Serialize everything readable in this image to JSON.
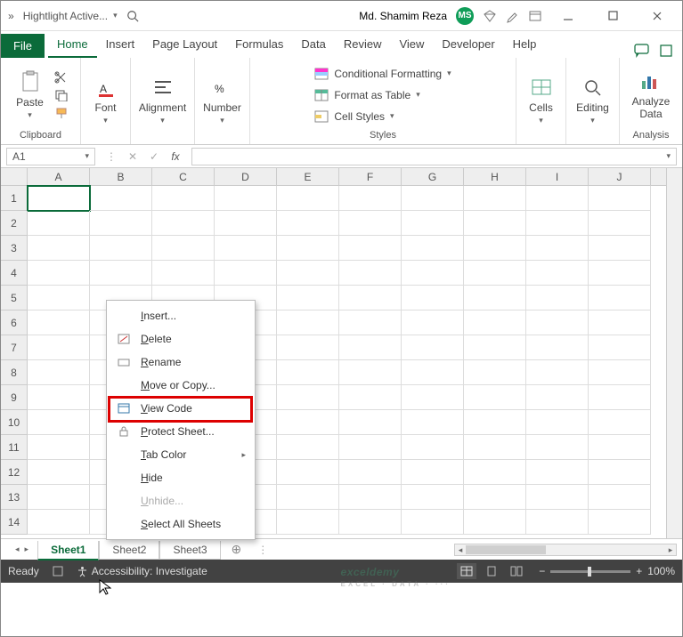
{
  "title": {
    "chevron": "»",
    "filename": "Hightlight Active...",
    "user": "Md. Shamim Reza",
    "avatar": "MS"
  },
  "tabs": {
    "file": "File",
    "home": "Home",
    "insert": "Insert",
    "page_layout": "Page Layout",
    "formulas": "Formulas",
    "data": "Data",
    "review": "Review",
    "view": "View",
    "developer": "Developer",
    "help": "Help"
  },
  "ribbon": {
    "clipboard": {
      "label": "Clipboard",
      "paste": "Paste"
    },
    "font": {
      "label": "Font"
    },
    "alignment": {
      "label": "Alignment"
    },
    "number": {
      "label": "Number"
    },
    "styles": {
      "label": "Styles",
      "cond": "Conditional Formatting",
      "table": "Format as Table",
      "cellstyles": "Cell Styles"
    },
    "cells": {
      "label": "Cells"
    },
    "editing": {
      "label": "Editing"
    },
    "analysis": {
      "label": "Analysis",
      "analyze": "Analyze Data"
    }
  },
  "namebox": "A1",
  "columns": [
    "A",
    "B",
    "C",
    "D",
    "E",
    "F",
    "G",
    "H",
    "I",
    "J"
  ],
  "rows": [
    "1",
    "2",
    "3",
    "4",
    "5",
    "6",
    "7",
    "8",
    "9",
    "10",
    "11",
    "12",
    "13",
    "14"
  ],
  "context": {
    "insert": "Insert...",
    "delete": "Delete",
    "rename": "Rename",
    "move": "Move or Copy...",
    "viewcode": "View Code",
    "protect": "Protect Sheet...",
    "tabcolor": "Tab Color",
    "hide": "Hide",
    "unhide": "Unhide...",
    "selectall": "Select All Sheets"
  },
  "sheets": {
    "s1": "Sheet1",
    "s2": "Sheet2",
    "s3": "Sheet3"
  },
  "status": {
    "ready": "Ready",
    "acc": "Accessibility: Investigate",
    "zoom": "100%"
  },
  "watermark": {
    "main": "exceldemy",
    "sub": "EXCEL · DATA · ···"
  }
}
